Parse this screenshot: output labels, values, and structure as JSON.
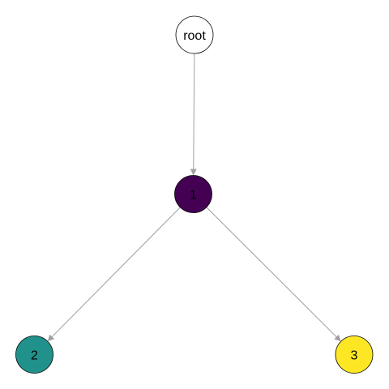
{
  "diagram": {
    "type": "tree",
    "nodes": [
      {
        "id": "root",
        "label": "root",
        "fill": "#ffffff",
        "text_color": "#000000"
      },
      {
        "id": "1",
        "label": "1",
        "fill": "#440154",
        "text_color": "#000000"
      },
      {
        "id": "2",
        "label": "2",
        "fill": "#21918c",
        "text_color": "#000000"
      },
      {
        "id": "3",
        "label": "3",
        "fill": "#fde725",
        "text_color": "#000000"
      }
    ],
    "edges": [
      {
        "from": "root",
        "to": "1"
      },
      {
        "from": "1",
        "to": "2"
      },
      {
        "from": "1",
        "to": "3"
      }
    ],
    "colors": {
      "edge": "#a0a0a0",
      "node_stroke": "#000000"
    }
  }
}
